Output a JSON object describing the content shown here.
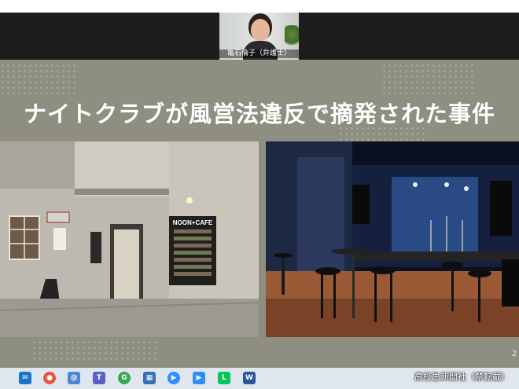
{
  "meeting": {
    "participant_name": "亀石倫子（弁護士）"
  },
  "slide": {
    "title": "ナイトクラブが風営法違反で摘発された事件",
    "page_number": "2",
    "cafe_sign": "NOON+CAFE",
    "door_sign": "NOON CAFE"
  },
  "taskbar": {
    "icons": [
      "mail-icon",
      "chrome-icon",
      "at-icon",
      "teams-icon",
      "google-chrome-icon",
      "calculator-icon",
      "zoom-icon",
      "zoom-meeting-icon",
      "line-icon",
      "word-icon"
    ]
  },
  "watermark": "高校生新聞社（禁転載）"
}
